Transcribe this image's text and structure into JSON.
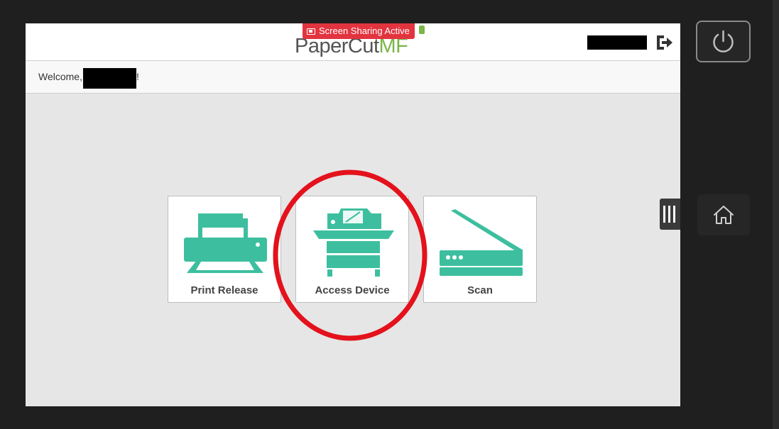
{
  "header": {
    "logo_main": "PaperCut",
    "logo_suffix": "MF",
    "screen_sharing_badge": "Screen Sharing Active"
  },
  "welcome": {
    "prefix": "Welcome,",
    "suffix": "!"
  },
  "tiles": [
    {
      "label": "Print Release",
      "icon": "printer-icon"
    },
    {
      "label": "Access Device",
      "icon": "copier-icon"
    },
    {
      "label": "Scan",
      "icon": "scanner-icon"
    }
  ],
  "colors": {
    "accent": "#3dbf9f",
    "badge": "#e2343f",
    "annotation": "#e3121c",
    "logo_mf": "#7ab648"
  },
  "device": {
    "power_icon": "power-icon",
    "home_icon": "home-icon",
    "handle_icon": "menu-handle-icon"
  }
}
